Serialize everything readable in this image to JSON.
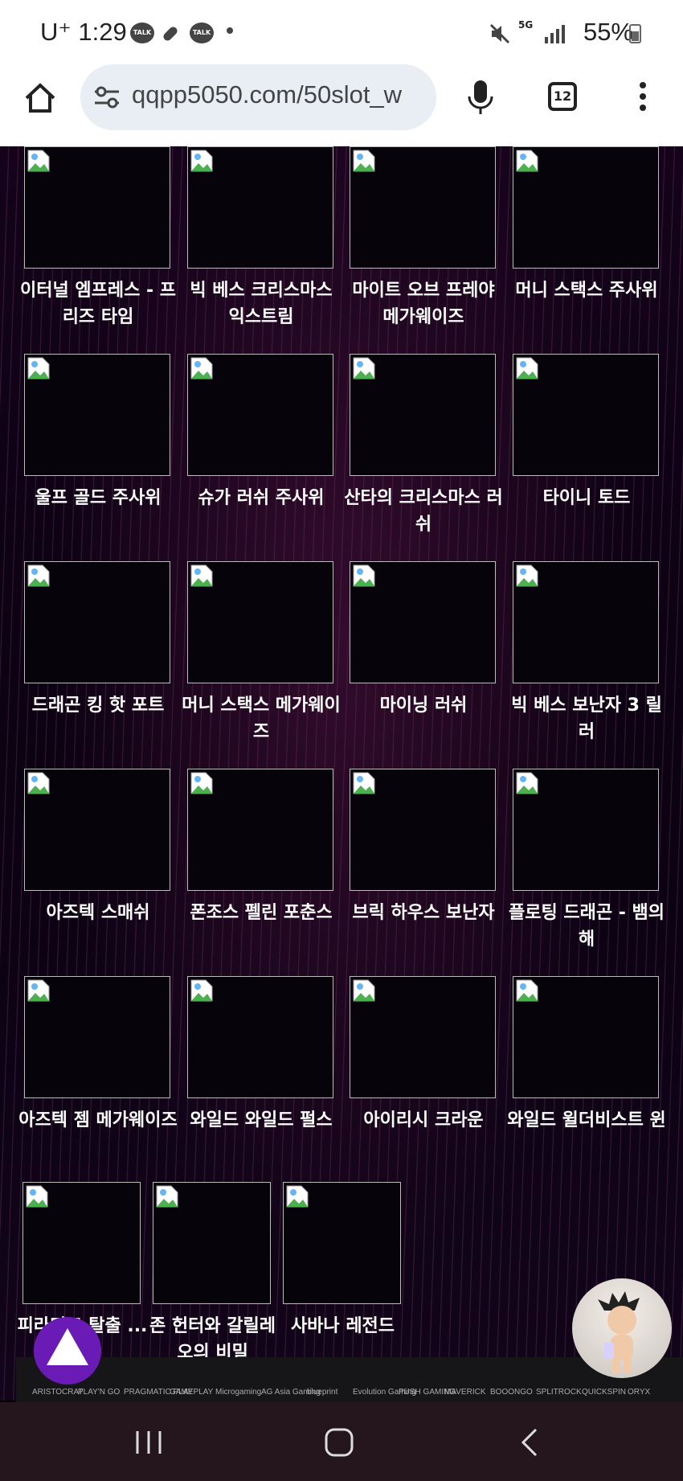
{
  "status_bar": {
    "time": "U⁺ 1:29",
    "talk": "TALK",
    "network": "5G",
    "battery": "55%"
  },
  "browser": {
    "url": "qqpp5050.com/50slot_w",
    "tab_count": "12"
  },
  "games": [
    {
      "name": "이터널 엠프레스 - 프리즈 타임"
    },
    {
      "name": "빅 베스 크리스마스 익스트림"
    },
    {
      "name": "마이트 오브 프레야 메가웨이즈"
    },
    {
      "name": "머니 스택스 주사위"
    },
    {
      "name": "울프 골드 주사위"
    },
    {
      "name": "슈가 러쉬 주사위"
    },
    {
      "name": "산타의 크리스마스 러쉬"
    },
    {
      "name": "타이니 토드"
    },
    {
      "name": "드래곤 킹 핫 포트"
    },
    {
      "name": "머니 스택스 메가웨이즈"
    },
    {
      "name": "마이닝 러쉬"
    },
    {
      "name": "빅 베스 보난자 3 릴러"
    },
    {
      "name": "아즈텍 스매쉬"
    },
    {
      "name": "폰조스 펠린 포춘스"
    },
    {
      "name": "브릭 하우스 보난자"
    },
    {
      "name": "플로팅 드래곤 - 뱀의 해"
    },
    {
      "name": "아즈텍 젬 메가웨이즈"
    },
    {
      "name": "와일드 와일드 펄스"
    },
    {
      "name": "아이리시 크라운"
    },
    {
      "name": "와일드 윌더비스트 윈"
    },
    {
      "name": "피라미드 탈출 ...없음"
    },
    {
      "name": "존 헌터와 갈릴레오의 비밀"
    },
    {
      "name": "사바나 레전드"
    }
  ],
  "providers": [
    "ARISTOCRAT",
    "PLAY'N GO",
    "PRAGMATIC PLAY",
    "GAMEPLAY",
    "Microgaming",
    "AG Asia Gaming",
    "blueprint",
    "Evolution Gaming",
    "PUSH GAMING",
    "MAVERICK",
    "BOOONGO",
    "SPLITROCK",
    "QUICKSPIN",
    "ORYX"
  ]
}
